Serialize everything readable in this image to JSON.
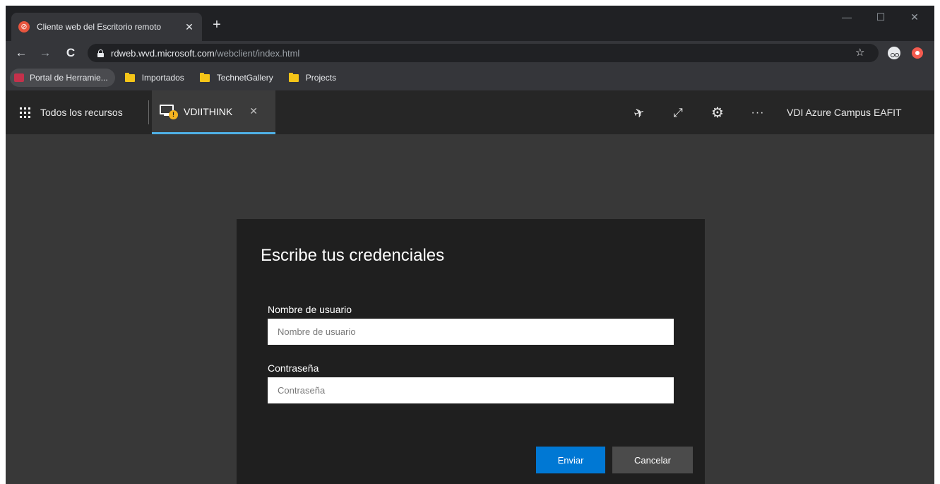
{
  "browser": {
    "tab_title": "Cliente web del Escritorio remoto",
    "tab_close": "✕",
    "new_tab": "+",
    "window_controls": {
      "minimize": "—",
      "maximize": "☐",
      "close": "✕"
    },
    "address": {
      "host": "rdweb.wvd.microsoft.com",
      "path": "/webclient/index.html"
    },
    "bookmarks": [
      {
        "label": "Portal de Herramie...",
        "icon": "portal-favicon"
      },
      {
        "label": "Importados",
        "icon": "folder-icon"
      },
      {
        "label": "TechnetGallery",
        "icon": "folder-icon"
      },
      {
        "label": "Projects",
        "icon": "folder-icon"
      }
    ]
  },
  "rdclient": {
    "all_resources_label": "Todos los recursos",
    "session_tab": {
      "name": "VDIITHINK",
      "close": "✕",
      "warning": "!"
    },
    "workspace_name": "VDI Azure Campus EAFIT",
    "toolbar_icons": [
      "pin-icon",
      "fullscreen-icon",
      "gear-icon",
      "more-icon"
    ]
  },
  "dialog": {
    "title": "Escribe tus credenciales",
    "username": {
      "label": "Nombre de usuario",
      "placeholder": "Nombre de usuario",
      "value": ""
    },
    "password": {
      "label": "Contraseña",
      "placeholder": "Contraseña",
      "value": ""
    },
    "submit_label": "Enviar",
    "cancel_label": "Cancelar"
  },
  "colors": {
    "accent": "#0078d4",
    "session_tab_underline": "#4fb0e6",
    "warning": "#f3b321",
    "bookmark_folder": "#f5c518"
  }
}
